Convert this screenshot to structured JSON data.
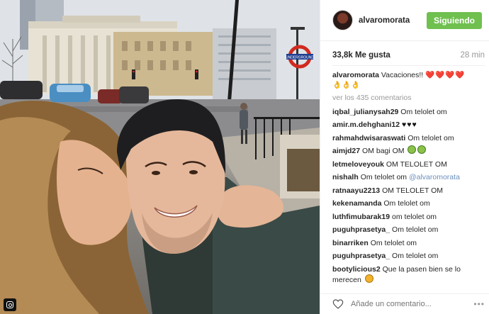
{
  "header": {
    "username": "alvaromorata",
    "follow_label": "Siguiendo"
  },
  "stats": {
    "likes": "33,8k Me gusta",
    "time_ago": "28 min"
  },
  "caption": {
    "username": "alvaromorata",
    "text": "Vacaciones!!",
    "emoji_hearts": "❤️❤️❤️❤️",
    "emoji_hands": "👌👌👌"
  },
  "view_comments": "ver los 435 comentarios",
  "comments": [
    {
      "user": "iqbal_julianysah29",
      "text": "Om telolet om"
    },
    {
      "user": "amir.m.dehghani12",
      "text": "",
      "extra": "♥♥♥"
    },
    {
      "user": "rahmahdwisaraswati",
      "text": "Om telolet om"
    },
    {
      "user": "aimjd27",
      "text": "OM bagi OM"
    },
    {
      "user": "letmeloveyouk",
      "text": "OM TELOLET OM"
    },
    {
      "user": "nishalh",
      "text": "Om telolet om",
      "mention": "@alvaromorata"
    },
    {
      "user": "ratnaayu2213",
      "text": "OM TELOLET OM"
    },
    {
      "user": "kekenamanda",
      "text": "Om telolet om"
    },
    {
      "user": "luthfimubarak19",
      "text": "om telolet om"
    },
    {
      "user": "puguhprasetya_",
      "text": "Om telolet om"
    },
    {
      "user": "binarriken",
      "text": "Om telolet om"
    },
    {
      "user": "puguhprasetya_",
      "text": "Om telolet om"
    }
  ],
  "last_comment": {
    "user": "bootylicious2",
    "text": "Que la pasen bien se lo merecen"
  },
  "footer": {
    "comment_placeholder": "Añade un comentario...",
    "more_label": "•••"
  },
  "photo": {
    "station_sign": "UNDERGROUND"
  },
  "colors": {
    "follow_button": "#70c050",
    "link": "#6b8fbd",
    "muted": "#999999",
    "heart_red": "#e0182d"
  }
}
